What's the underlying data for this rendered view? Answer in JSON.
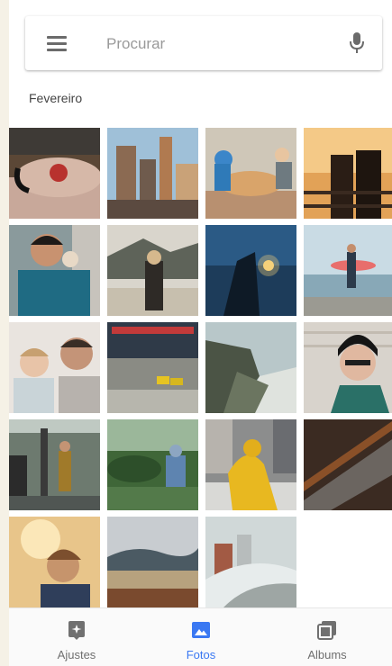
{
  "search": {
    "placeholder": "Procurar",
    "menu_icon": "hamburger-menu-icon",
    "mic_icon": "microphone-icon"
  },
  "section": {
    "title": "Fevereiro"
  },
  "nav": {
    "items": [
      {
        "label": "Ajustes",
        "icon": "adjust-icon",
        "active": false
      },
      {
        "label": "Fotos",
        "icon": "photo-icon",
        "active": true
      },
      {
        "label": "Albums",
        "icon": "albums-icon",
        "active": false
      }
    ]
  },
  "colors": {
    "accent": "#3a78f2",
    "inactive": "#707070"
  }
}
